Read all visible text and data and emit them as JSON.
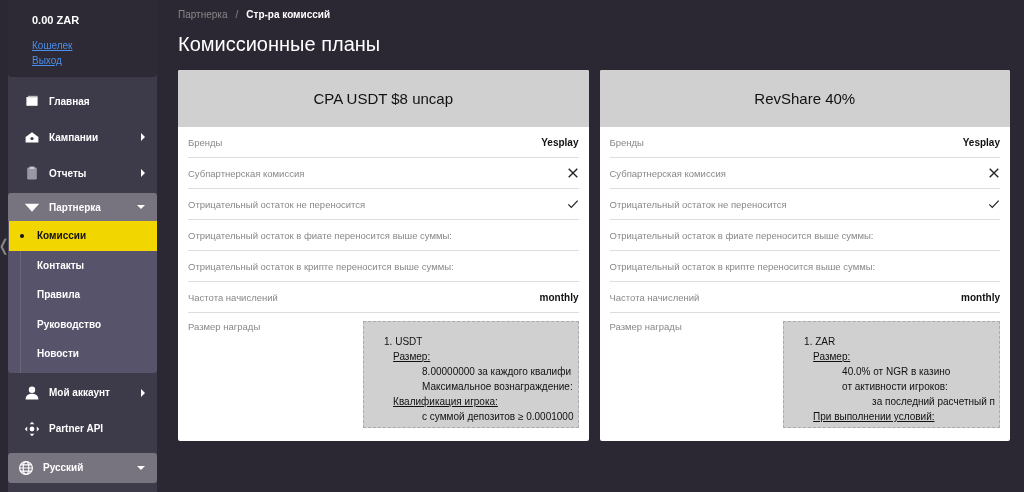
{
  "sidebar": {
    "wallet": {
      "balance": "0.00",
      "currency": "ZAR",
      "links": [
        "Кошелек",
        "Выход"
      ]
    },
    "items": [
      {
        "label": "Главная",
        "kind": "link"
      },
      {
        "label": "Кампании",
        "kind": "submenu"
      },
      {
        "label": "Отчеты",
        "kind": "submenu"
      },
      {
        "label": "Партнерка",
        "kind": "group",
        "children": [
          {
            "label": "Комиссии",
            "selected": true
          },
          {
            "label": "Контакты",
            "selected": false
          },
          {
            "label": "Правила",
            "selected": false
          },
          {
            "label": "Руководство",
            "selected": false
          },
          {
            "label": "Новости",
            "selected": false
          }
        ]
      },
      {
        "label": "Мой аккаунт",
        "kind": "submenu"
      },
      {
        "label": "Partner API",
        "kind": "link"
      }
    ],
    "language": "Русский"
  },
  "collapse_handle": "❬",
  "breadcrumb": [
    "Партнерка",
    "Стр-ра комиссий"
  ],
  "breadcrumb_separator": "/",
  "title": "Комиссионные планы",
  "plans": [
    {
      "name": "CPA USDT $8 uncap",
      "rows": [
        {
          "label": "Бренды",
          "kind": "text",
          "value": "Yesplay"
        },
        {
          "label": "Субпартнерская комиссия",
          "kind": "bool",
          "on": false
        },
        {
          "label": "Отрицательный остаток не переносится",
          "kind": "bool",
          "on": true
        },
        {
          "label": "Отрицательный остаток в фиате переносится выше суммы:",
          "kind": "empty"
        },
        {
          "label": "Отрицательный остаток в крипте переносится выше суммы:",
          "kind": "empty"
        },
        {
          "label": "Частота начислений",
          "kind": "text",
          "value": "monthly"
        }
      ],
      "reward_label": "Размер награды",
      "reward_lines": [
        {
          "kind": "title",
          "text": "1. USDT"
        },
        {
          "kind": "heading",
          "text": "Размер:"
        },
        {
          "kind": "detail",
          "text": "8.00000000 за каждого квалифи"
        },
        {
          "kind": "detail",
          "text": "Максимальное вознаграждение:"
        },
        {
          "kind": "heading",
          "text": "Квалификация игрока:"
        },
        {
          "kind": "detail",
          "text": "с суммой депозитов ≥ 0.0001000"
        }
      ]
    },
    {
      "name": "RevShare 40%",
      "rows": [
        {
          "label": "Бренды",
          "kind": "text",
          "value": "Yesplay"
        },
        {
          "label": "Субпартнерская комиссия",
          "kind": "bool",
          "on": false
        },
        {
          "label": "Отрицательный остаток не переносится",
          "kind": "bool",
          "on": true
        },
        {
          "label": "Отрицательный остаток в фиате переносится выше суммы:",
          "kind": "empty"
        },
        {
          "label": "Отрицательный остаток в крипте переносится выше суммы:",
          "kind": "empty"
        },
        {
          "label": "Частота начислений",
          "kind": "text",
          "value": "monthly"
        }
      ],
      "reward_label": "Размер награды",
      "reward_lines": [
        {
          "kind": "title",
          "text": "1. ZAR"
        },
        {
          "kind": "heading",
          "text": "Размер:"
        },
        {
          "kind": "detail",
          "text": "40.0% от NGR в казино"
        },
        {
          "kind": "detail",
          "text": "от активности игроков:"
        },
        {
          "kind": "subdetail",
          "text": "за последний расчетный п"
        },
        {
          "kind": "heading",
          "text": "При выполнении условий:"
        }
      ]
    }
  ]
}
